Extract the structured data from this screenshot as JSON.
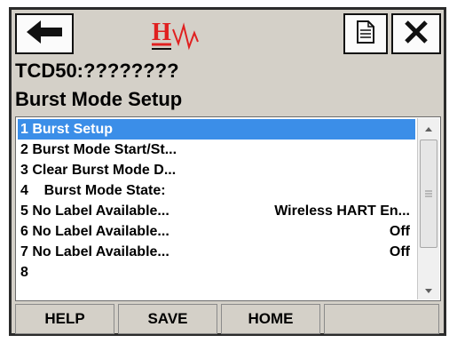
{
  "topbar": {
    "back_icon": "arrow-left-icon",
    "logo_text": "H",
    "doc_icon": "document-icon",
    "close_icon": "close-icon"
  },
  "device_name": "TCD50:????????",
  "screen_title": "Burst Mode Setup",
  "menu": {
    "items": [
      {
        "label": "1 Burst Setup",
        "value": "",
        "selected": true
      },
      {
        "label": "2 Burst Mode Start/St...",
        "value": ""
      },
      {
        "label": "3 Clear Burst Mode D...",
        "value": ""
      },
      {
        "label": "4    Burst Mode State:",
        "value": ""
      },
      {
        "label": "5 No Label Available...",
        "value": "Wireless HART En..."
      },
      {
        "label": "6 No Label Available...",
        "value": "Off"
      },
      {
        "label": "7 No Label Available...",
        "value": "Off"
      },
      {
        "label": "8",
        "value": ""
      }
    ]
  },
  "bottombar": {
    "help": "HELP",
    "save": "SAVE",
    "home": "HOME",
    "blank": ""
  },
  "colors": {
    "selection": "#3b8ee8",
    "logo_red": "#e02020",
    "frame": "#d4d0c8"
  }
}
